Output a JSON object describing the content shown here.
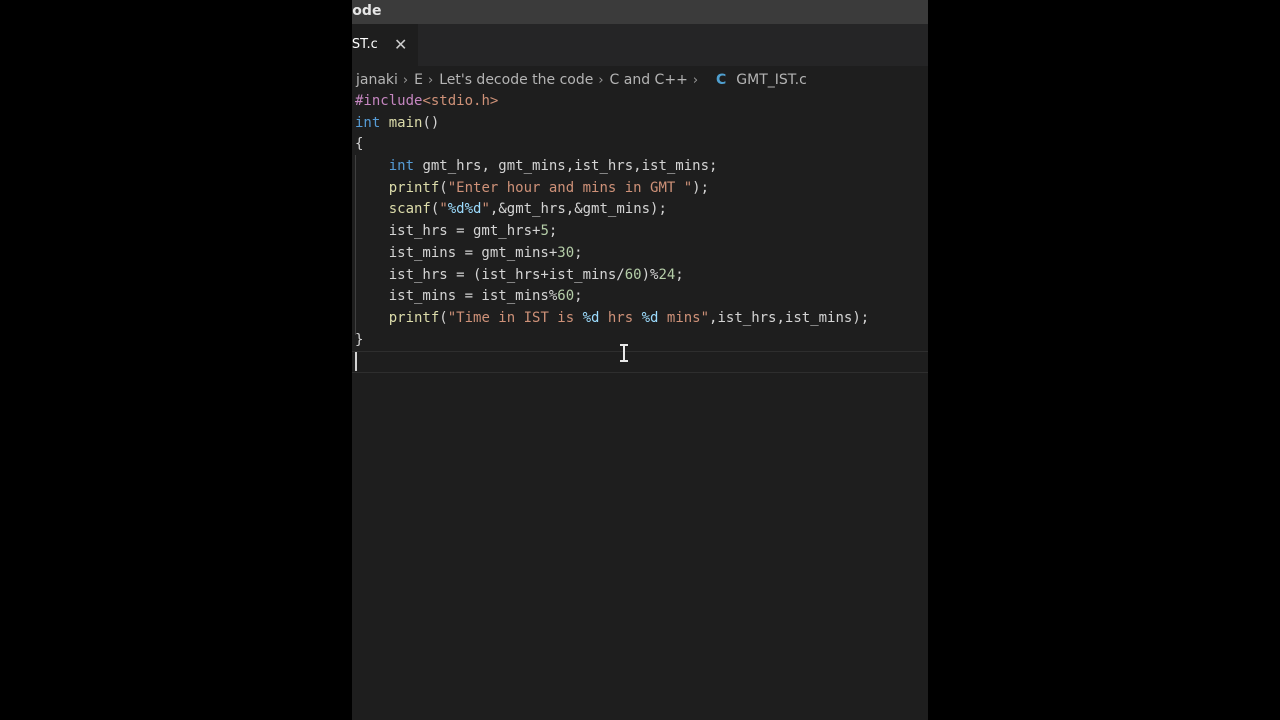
{
  "window": {
    "title": "code"
  },
  "tab": {
    "label": "IST.c",
    "close": "✕"
  },
  "breadcrumb": {
    "items": [
      "janaki",
      "E",
      "Let's decode the code",
      "C and C++"
    ],
    "file_icon": "C",
    "file": "GMT_IST.c",
    "separator": "›"
  },
  "code": {
    "lines": [
      [
        {
          "t": "#include",
          "c": "pp"
        },
        {
          "t": "<stdio.h>",
          "c": "inc"
        }
      ],
      [
        {
          "t": "int",
          "c": "kw"
        },
        {
          "t": " ",
          "c": "id"
        },
        {
          "t": "main",
          "c": "fn"
        },
        {
          "t": "()",
          "c": "id"
        }
      ],
      [
        {
          "t": "{",
          "c": "id"
        }
      ],
      [
        {
          "t": "    ",
          "c": "id"
        },
        {
          "t": "int",
          "c": "kw"
        },
        {
          "t": " gmt_hrs, gmt_mins,ist_hrs,ist_mins;",
          "c": "id"
        }
      ],
      [
        {
          "t": "    ",
          "c": "id"
        },
        {
          "t": "printf",
          "c": "fn"
        },
        {
          "t": "(",
          "c": "id"
        },
        {
          "t": "\"Enter hour and mins in GMT \"",
          "c": "str"
        },
        {
          "t": ");",
          "c": "id"
        }
      ],
      [
        {
          "t": "    ",
          "c": "id"
        },
        {
          "t": "scanf",
          "c": "fn"
        },
        {
          "t": "(",
          "c": "id"
        },
        {
          "t": "\"",
          "c": "str"
        },
        {
          "t": "%d%d",
          "c": "fmt"
        },
        {
          "t": "\"",
          "c": "str"
        },
        {
          "t": ",&gmt_hrs,&gmt_mins);",
          "c": "id"
        }
      ],
      [
        {
          "t": "    ist_hrs = gmt_hrs+",
          "c": "id"
        },
        {
          "t": "5",
          "c": "num"
        },
        {
          "t": ";",
          "c": "id"
        }
      ],
      [
        {
          "t": "    ist_mins = gmt_mins+",
          "c": "id"
        },
        {
          "t": "30",
          "c": "num"
        },
        {
          "t": ";",
          "c": "id"
        }
      ],
      [
        {
          "t": "    ist_hrs = (ist_hrs+ist_mins/",
          "c": "id"
        },
        {
          "t": "60",
          "c": "num"
        },
        {
          "t": ")%",
          "c": "id"
        },
        {
          "t": "24",
          "c": "num"
        },
        {
          "t": ";",
          "c": "id"
        }
      ],
      [
        {
          "t": "    ist_mins = ist_mins%",
          "c": "id"
        },
        {
          "t": "60",
          "c": "num"
        },
        {
          "t": ";",
          "c": "id"
        }
      ],
      [
        {
          "t": "    ",
          "c": "id"
        },
        {
          "t": "printf",
          "c": "fn"
        },
        {
          "t": "(",
          "c": "id"
        },
        {
          "t": "\"Time in IST is ",
          "c": "str"
        },
        {
          "t": "%d",
          "c": "fmt"
        },
        {
          "t": " hrs ",
          "c": "str"
        },
        {
          "t": "%d",
          "c": "fmt"
        },
        {
          "t": " mins\"",
          "c": "str"
        },
        {
          "t": ",ist_hrs,ist_mins);",
          "c": "id"
        }
      ],
      [
        {
          "t": "}",
          "c": "id"
        }
      ],
      []
    ]
  }
}
